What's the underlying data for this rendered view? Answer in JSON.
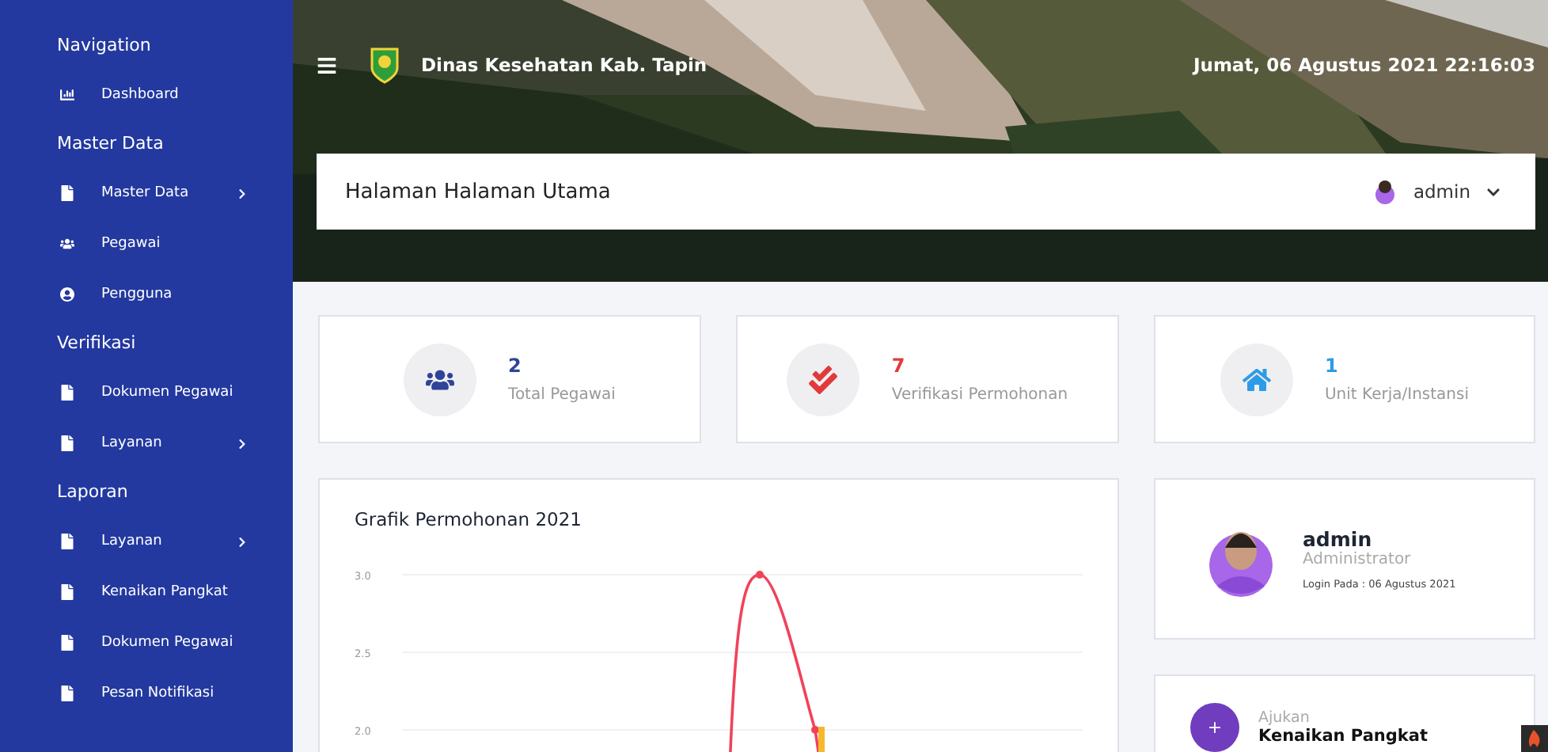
{
  "sidebar": {
    "sections": [
      {
        "title": "Navigation",
        "items": [
          {
            "label": "Dashboard",
            "kind": "dashboard",
            "has_submenu": false
          }
        ]
      },
      {
        "title": "Master Data",
        "items": [
          {
            "label": "Master Data",
            "kind": "file",
            "has_submenu": true
          },
          {
            "label": "Pegawai",
            "kind": "people",
            "has_submenu": false
          },
          {
            "label": "Pengguna",
            "kind": "user",
            "has_submenu": false
          }
        ]
      },
      {
        "title": "Verifikasi",
        "items": [
          {
            "label": "Dokumen Pegawai",
            "kind": "file",
            "has_submenu": false
          },
          {
            "label": "Layanan",
            "kind": "file",
            "has_submenu": true
          }
        ]
      },
      {
        "title": "Laporan",
        "items": [
          {
            "label": "Layanan",
            "kind": "file",
            "has_submenu": true
          },
          {
            "label": "Kenaikan Pangkat",
            "kind": "file",
            "has_submenu": false
          },
          {
            "label": "Dokumen Pegawai",
            "kind": "file",
            "has_submenu": false
          },
          {
            "label": "Pesan Notifikasi",
            "kind": "file",
            "has_submenu": false
          }
        ]
      }
    ]
  },
  "header": {
    "title": "Dinas Kesehatan Kab. Tapin",
    "datetime": "Jumat, 06 Agustus 2021 22:16:03"
  },
  "page_title": "Halaman Halaman Utama",
  "user_menu": {
    "name": "admin"
  },
  "stats": [
    {
      "value": "2",
      "label": "Total Pegawai",
      "kind": "people",
      "color": "#2f4497"
    },
    {
      "value": "7",
      "label": "Verifikasi Permohonan",
      "kind": "check",
      "color": "#e23a3a"
    },
    {
      "value": "1",
      "label": "Unit Kerja/Instansi",
      "kind": "home",
      "color": "#2e9be6"
    }
  ],
  "chart": {
    "title": "Grafik Permohonan 2021",
    "y_axis_labels": [
      "3.0",
      "2.5",
      "2.0"
    ]
  },
  "profile": {
    "name": "admin",
    "role": "Administrator",
    "login": "Login Pada : 06 Agustus 2021"
  },
  "action": {
    "caption": "Ajukan",
    "label": "Kenaikan Pangkat",
    "icon": "+"
  }
}
